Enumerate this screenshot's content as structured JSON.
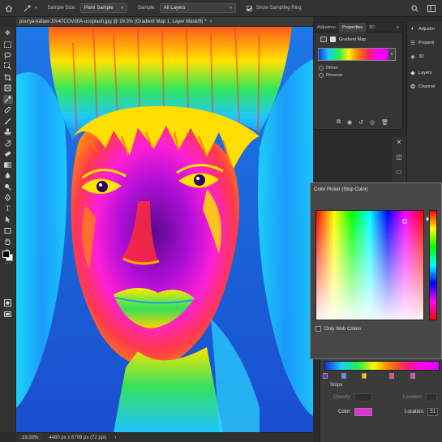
{
  "options": {
    "sample_size_label": "Sample Size:",
    "sample_size_value": "Point Sample",
    "sample_label": "Sample:",
    "sample_value": "All Layers",
    "show_ring_label": "Show Sampling Ring"
  },
  "document": {
    "tab_title": "pourya-kafaei-J0v47COVd0A-unsplash.jpg @ 19.3% (Gradient Map 1, Layer Mask/8) *",
    "close": "×"
  },
  "status": {
    "zoom": "19.33%",
    "info": "4480 px x 6709 px (72 ppi)"
  },
  "properties": {
    "tabs": [
      "Adjustme",
      "Properties",
      "3D"
    ],
    "active_tab": "Properties",
    "layer_type": "Gradient Map",
    "options": [
      "Dither",
      "Reverse"
    ]
  },
  "dock": {
    "items": [
      "Adjustm",
      "Properti",
      "3D",
      "Layers",
      "Channel"
    ]
  },
  "color_picker": {
    "title": "Color Picker (Stop Color)",
    "only_web_colors": "Only Web Colors",
    "hue_accent": "#ff00ff"
  },
  "gradient_editor": {
    "stops_label": "Stops",
    "opacity_label": "Opacity:",
    "location_label": "Location:",
    "color_label": "Color:",
    "color_value": "#e62ae2",
    "location_value": "51",
    "stop_colors": [
      "#6a2fd6",
      "#3aa1ff",
      "#ffd200",
      "#ff3ca0",
      "#ff37c8"
    ]
  }
}
